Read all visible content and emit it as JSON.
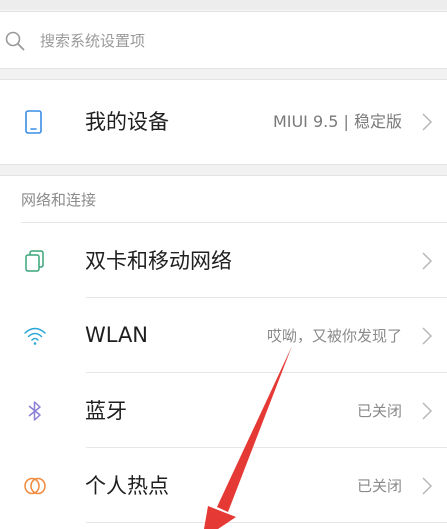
{
  "search": {
    "placeholder": "搜索系统设置项"
  },
  "device": {
    "label": "我的设备",
    "value": "MIUI 9.5 | 稳定版",
    "icon": "phone-icon"
  },
  "network_section": {
    "title": "网络和连接",
    "items": [
      {
        "label": "双卡和移动网络",
        "value": "",
        "icon": "dual-sim-icon"
      },
      {
        "label": "WLAN",
        "value": "哎呦，又被你发现了",
        "icon": "wifi-icon"
      },
      {
        "label": "蓝牙",
        "value": "已关闭",
        "icon": "bluetooth-icon"
      },
      {
        "label": "个人热点",
        "value": "已关闭",
        "icon": "hotspot-icon"
      }
    ]
  },
  "colors": {
    "device_icon": "#3a8ee6",
    "sim_icon": "#3aa57a",
    "wifi_icon": "#2aa6d8",
    "bluetooth_icon": "#8b7fd6",
    "hotspot_icon": "#f08a3c",
    "annotation_arrow": "#e53935"
  }
}
